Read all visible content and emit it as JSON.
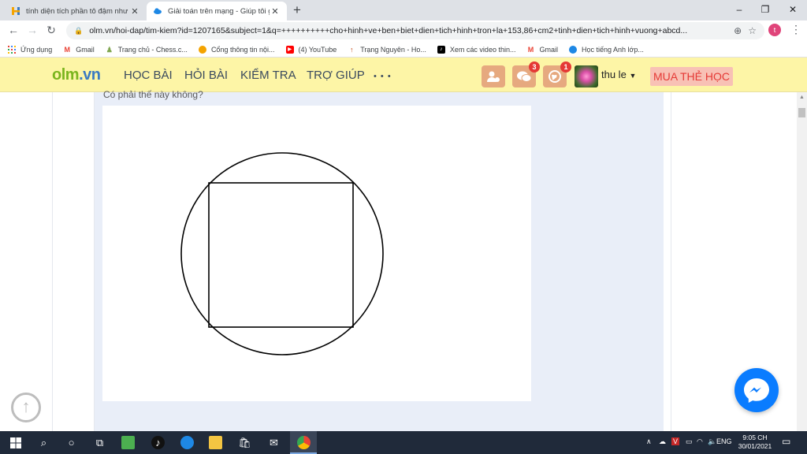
{
  "browser": {
    "tabs": [
      {
        "title": "tính diện tích phần tô đậm như h",
        "active": false
      },
      {
        "title": "Giải toán trên mạng - Giúp tôi gi",
        "active": true
      }
    ],
    "new_tab_symbol": "+",
    "window_controls": {
      "minimize": "–",
      "restore": "❐",
      "close": "✕"
    },
    "url": "olm.vn/hoi-dap/tim-kiem?id=1207165&subject=1&q=++++++++++cho+hinh+ve+ben+biet+dien+tich+hinh+tron+la+153,86+cm2+tinh+dien+tich+hinh+vuong+abcd...",
    "profile_initial": "t",
    "bookmarks": [
      {
        "label": "Ứng dụng",
        "icon": "apps-grid-icon",
        "color": "#e94235"
      },
      {
        "label": "Gmail",
        "icon": "gmail-icon",
        "color": "#ea4335"
      },
      {
        "label": "Trang chủ - Chess.c...",
        "icon": "chess-pawn-icon",
        "color": "#7fa650"
      },
      {
        "label": "Cổng thông tin nội...",
        "icon": "portal-icon",
        "color": "#f4a300"
      },
      {
        "label": "(4) YouTube",
        "icon": "youtube-icon",
        "color": "#ff0000"
      },
      {
        "label": "Trạng Nguyên - Ho...",
        "icon": "pin-icon",
        "color": "#c2410c"
      },
      {
        "label": "Xem các video thin...",
        "icon": "tiktok-icon",
        "color": "#000000"
      },
      {
        "label": "Gmail",
        "icon": "gmail-icon",
        "color": "#ea4335"
      },
      {
        "label": "Học tiếng Anh lớp...",
        "icon": "globe-icon",
        "color": "#1e88e5"
      }
    ]
  },
  "site": {
    "logo_main": "olm",
    "logo_dot": ".vn",
    "nav": [
      "HỌC BÀI",
      "HỎI BÀI",
      "KIỂM TRA",
      "TRỢ GIÚP"
    ],
    "more": "• • •",
    "notifications": {
      "messages": "3",
      "world": "1"
    },
    "username": "thu le",
    "buy_label": "MUA THẺ HỌC",
    "accent": "#fdf5a6"
  },
  "content": {
    "question": "Có phải thế này không?",
    "figure": {
      "shapes": [
        "circle",
        "inscribed-square"
      ]
    }
  },
  "taskbar": {
    "lang": "ENG",
    "time": "9:05 CH",
    "date": "30/01/2021"
  }
}
